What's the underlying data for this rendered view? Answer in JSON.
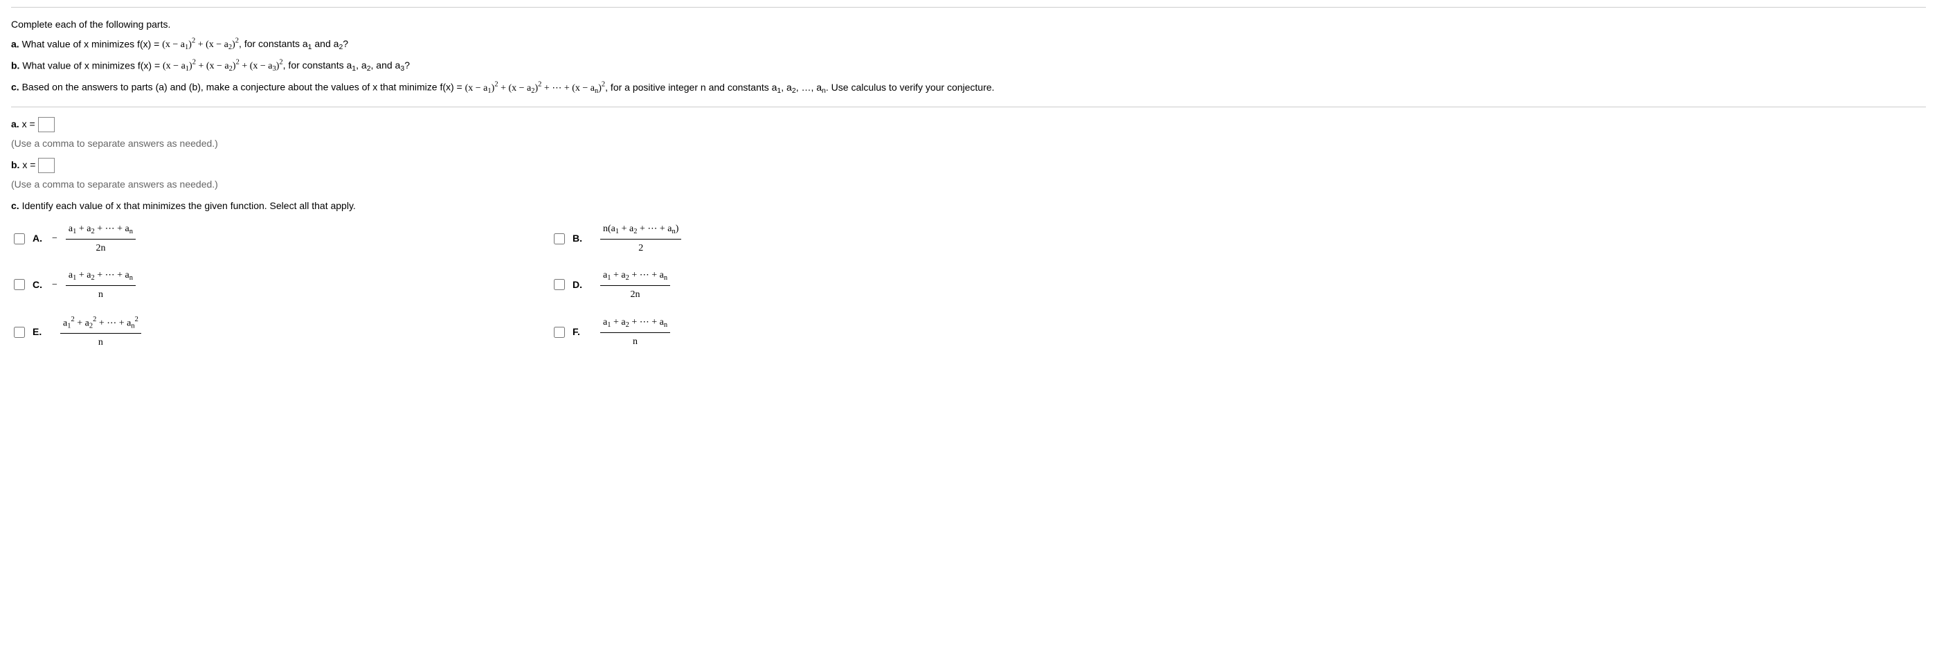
{
  "intro": "Complete each of the following parts.",
  "partA": {
    "label": "a.",
    "prefix": " What value of x minimizes f(x) = ",
    "eq": "(x − a₁)² + (x − a₂)²",
    "suffix": ", for constants a₁ and a₂?"
  },
  "partB": {
    "label": "b.",
    "prefix": " What value of x minimizes f(x) = ",
    "eq": "(x − a₁)² + (x − a₂)² + (x − a₃)²",
    "suffix": ", for constants a₁, a₂, and a₃?"
  },
  "partC": {
    "label": "c.",
    "prefix": " Based on the answers to parts (a) and (b), make a conjecture about the values of x that minimize f(x) = ",
    "eq": "(x − a₁)² + (x − a₂)² + ⋯ + (x − aₙ)²",
    "suffix": ", for a positive integer n and constants a₁, a₂, …, aₙ. Use calculus to verify your conjecture."
  },
  "answerA": {
    "label": "a.",
    "var": " x = "
  },
  "answerB": {
    "label": "b.",
    "var": " x = "
  },
  "hint": "(Use a comma to separate answers as needed.)",
  "partCprompt": {
    "label": "c.",
    "text": " Identify each value of x that minimizes the given function. Select all that apply."
  },
  "choices": {
    "A": {
      "letter": "A.",
      "neg": "−",
      "num": "a₁ + a₂ + ⋯ + aₙ",
      "den": "2n"
    },
    "B": {
      "letter": "B.",
      "neg": "",
      "num": "n(a₁ + a₂ + ⋯ + aₙ)",
      "den": "2"
    },
    "C": {
      "letter": "C.",
      "neg": "−",
      "num": "a₁ + a₂ + ⋯ + aₙ",
      "den": "n"
    },
    "D": {
      "letter": "D.",
      "neg": "",
      "num": "a₁ + a₂ + ⋯ + aₙ",
      "den": "2n"
    },
    "E": {
      "letter": "E.",
      "neg": "",
      "num": "a₁² + a₂² + ⋯ + aₙ²",
      "den": "n"
    },
    "F": {
      "letter": "F.",
      "neg": "",
      "num": "a₁ + a₂ + ⋯ + aₙ",
      "den": "n"
    }
  }
}
